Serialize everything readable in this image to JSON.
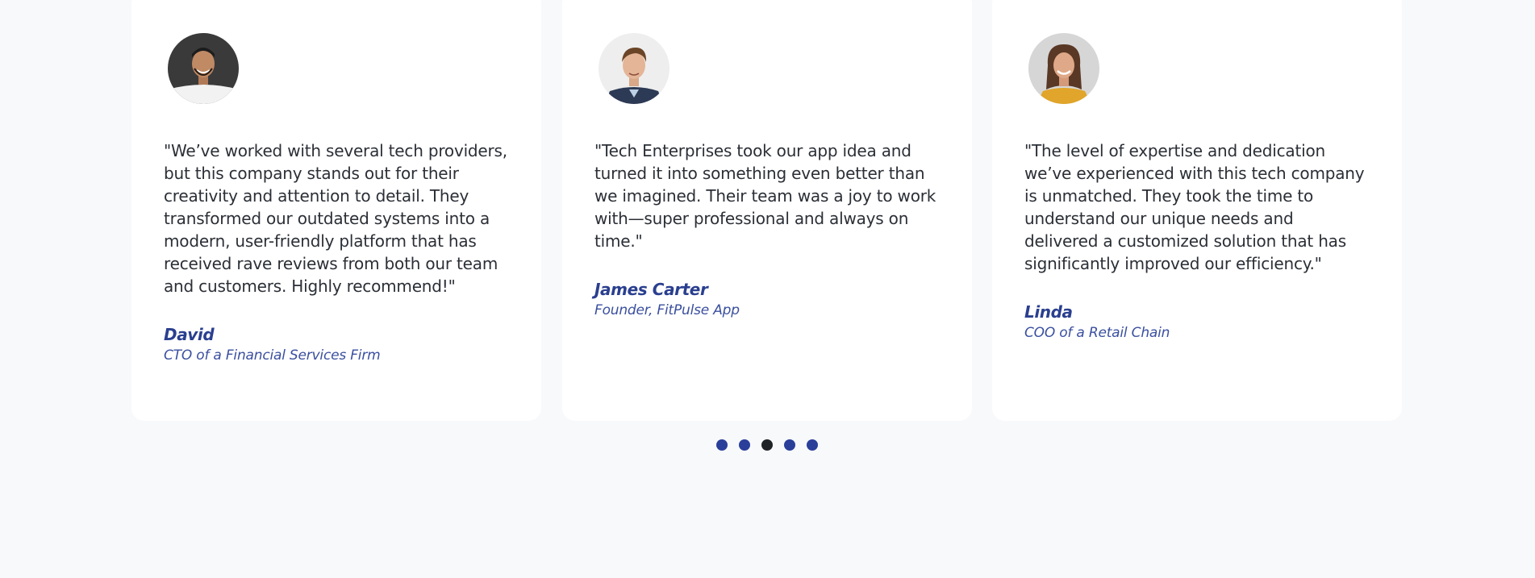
{
  "testimonials": [
    {
      "quote": "\"We’ve worked with several tech providers, but this company stands out for their creativity and attention to detail. They transformed our outdated systems into a modern, user-friendly platform that has received rave reviews from both our team and customers. Highly recommend!\"",
      "name": "David",
      "role": "CTO of a Financial Services Firm"
    },
    {
      "quote": "\"Tech Enterprises took our app idea and turned it into something even better than we imagined. Their team was a joy to work with—super professional and always on time.\"",
      "name": "James Carter",
      "role": "Founder, FitPulse App"
    },
    {
      "quote": "\"The level of expertise and dedication we’ve experienced with this tech company is unmatched. They took the time to understand our unique needs and delivered a customized solution that has significantly improved our efficiency.\"",
      "name": "Linda",
      "role": "COO of a Retail Chain"
    }
  ],
  "carousel": {
    "dot_count": 5,
    "active_index": 2
  },
  "colors": {
    "page_background": "#f8f9fb",
    "card_background": "#ffffff",
    "accent": "#2a3f8f",
    "dot": "#2a3f9a",
    "dot_active": "#1f2328",
    "body_text": "#2b2f36"
  },
  "icons": [
    "avatar-photo",
    "carousel-dot"
  ]
}
